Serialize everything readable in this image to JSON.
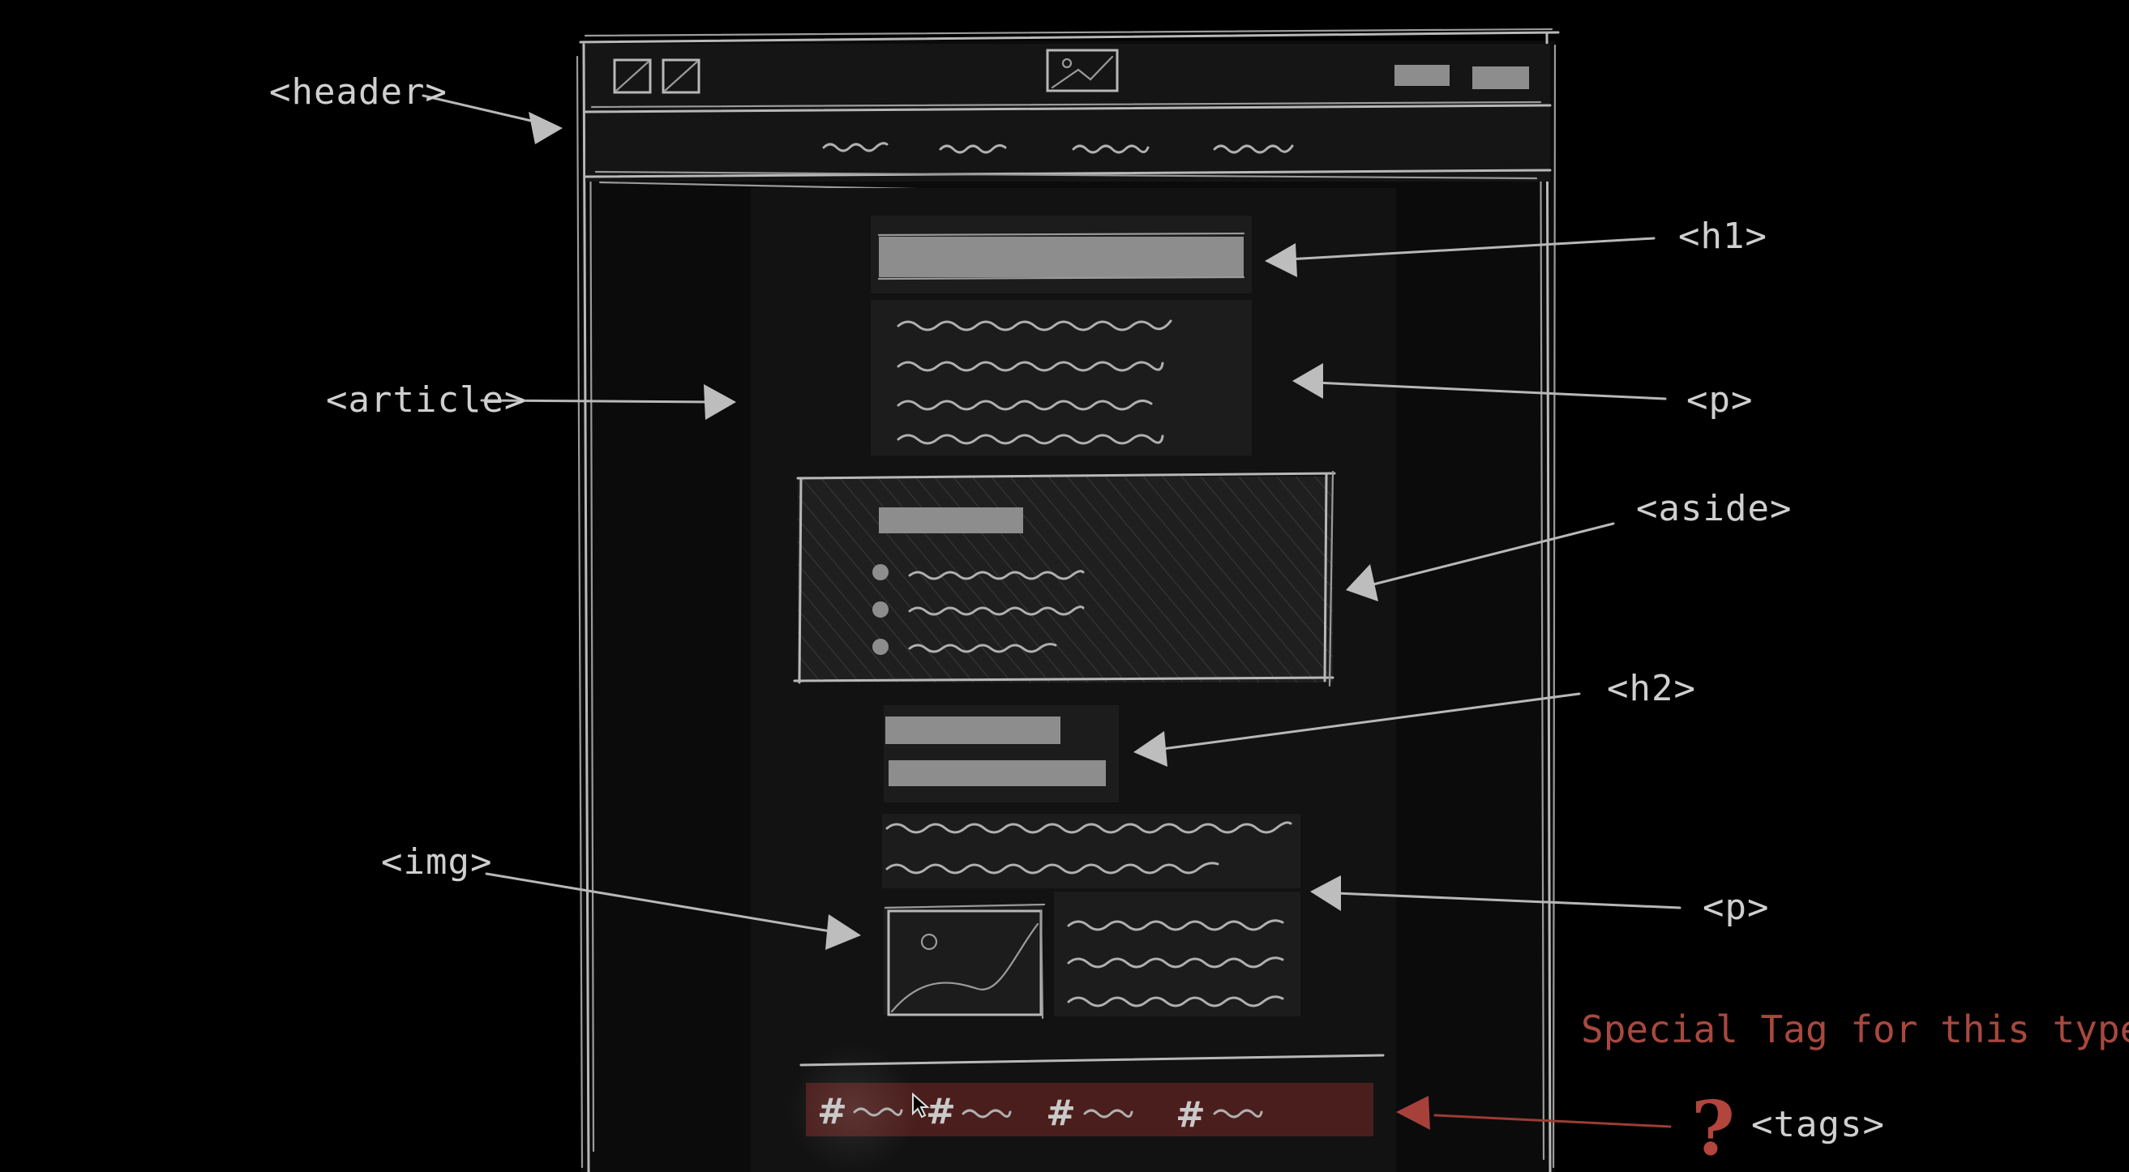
{
  "labels": {
    "header": "<header>",
    "h1": "<h1>",
    "article": "<article>",
    "p1": "<p>",
    "aside": "<aside>",
    "h2": "<h2>",
    "img": "<img>",
    "p2": "<p>",
    "tags": "<tags>"
  },
  "special_note": "Special Tag for this type of conte",
  "question_mark": "?",
  "tag_hash": "#",
  "colors": {
    "background": "#000000",
    "sketch": "#b8b8b8",
    "accent_red": "#a8483f",
    "tag_bar": "#4a1e1c"
  }
}
